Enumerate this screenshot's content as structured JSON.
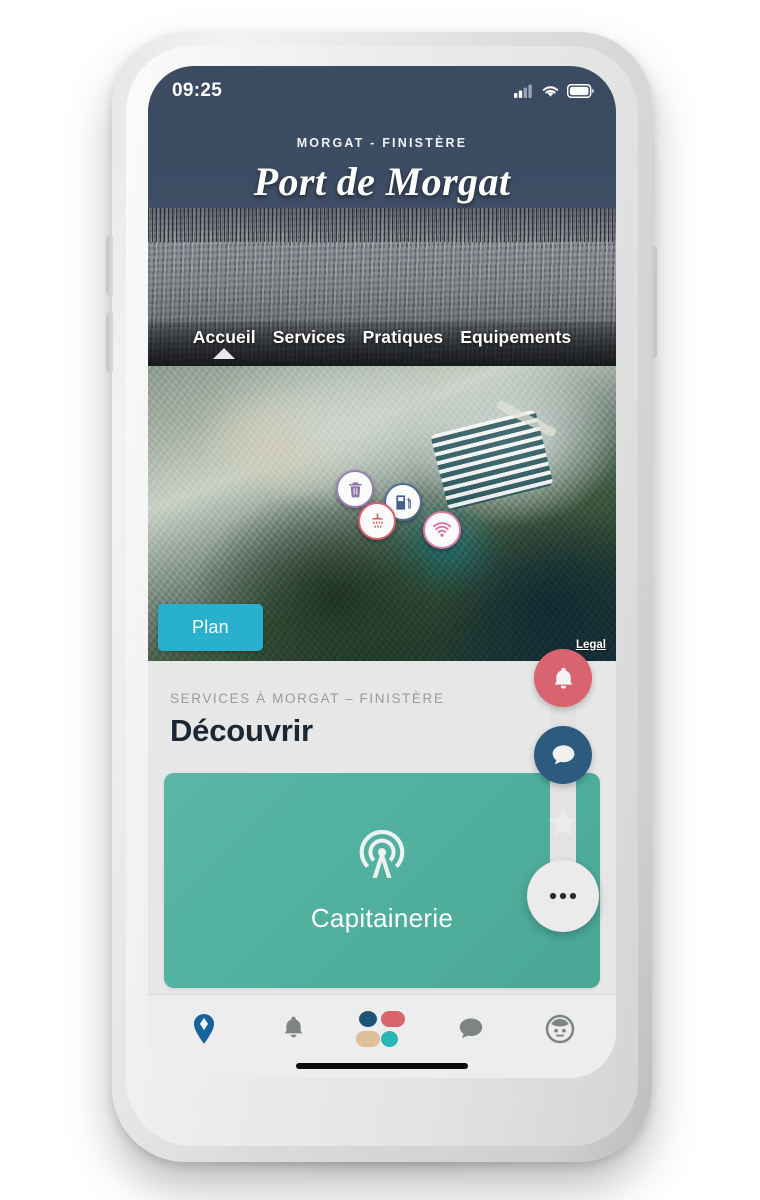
{
  "device": {
    "status_bar": {
      "time": "09:25",
      "icons": [
        "cellular-signal-icon",
        "wifi-icon",
        "battery-icon"
      ]
    },
    "home_indicator": true
  },
  "app_header": {
    "kicker": "MORGAT - FINISTÈRE",
    "title": "Port de Morgat",
    "background_color": "#3b4b62",
    "tabs": [
      {
        "label": "Accueil",
        "active": true
      },
      {
        "label": "Services",
        "active": false
      },
      {
        "label": "Pratiques",
        "active": false
      },
      {
        "label": "Equipements",
        "active": false
      }
    ]
  },
  "map": {
    "type": "satellite",
    "plan_button_label": "Plan",
    "plan_button_color": "#29b0cd",
    "legal_link_label": "Legal",
    "markers": [
      {
        "name": "waste-disposal-marker",
        "icon": "trash-icon",
        "color": "#9a7fb5"
      },
      {
        "name": "fuel-station-marker",
        "icon": "fuel-pump-icon",
        "color": "#4d6f96"
      },
      {
        "name": "shower-marker",
        "icon": "shower-icon",
        "color": "#d4606a"
      },
      {
        "name": "wifi-marker",
        "icon": "wifi-icon",
        "color": "#e07aa4"
      }
    ]
  },
  "content": {
    "kicker": "SERVICES À MORGAT – FINISTÈRE",
    "title": "Découvrir",
    "card": {
      "label": "Capitainerie",
      "icon": "beacon-tower-icon",
      "color": "#52b1a0"
    }
  },
  "fab_stack": [
    {
      "name": "alerts-fab",
      "icon": "bell-icon",
      "color": "#d7646f"
    },
    {
      "name": "messages-fab",
      "icon": "chat-bubble-icon",
      "color": "#2d5b80"
    },
    {
      "name": "favorites-fab",
      "icon": "star-icon",
      "color": "#e8e8e8"
    },
    {
      "name": "more-fab",
      "icon": "ellipsis-icon",
      "color": "#ebebeb"
    }
  ],
  "bottom_nav": [
    {
      "name": "nav-map",
      "icon": "location-pin-icon",
      "color": "#15639e",
      "active": true
    },
    {
      "name": "nav-alerts",
      "icon": "bell-icon",
      "color": "#7e8580",
      "active": false
    },
    {
      "name": "nav-home",
      "icon": "app-logo-icon",
      "color": "#1b5276",
      "active": false
    },
    {
      "name": "nav-messages",
      "icon": "chat-bubble-icon",
      "color": "#7e8580",
      "active": false
    },
    {
      "name": "nav-profile",
      "icon": "person-icon",
      "color": "#7e8580",
      "active": false
    }
  ],
  "brand_logo_colors": {
    "top_left": "#1b5276",
    "top_right": "#d9646e",
    "bottom_left": "#ddbf98",
    "bottom_right": "#29b5b5"
  }
}
